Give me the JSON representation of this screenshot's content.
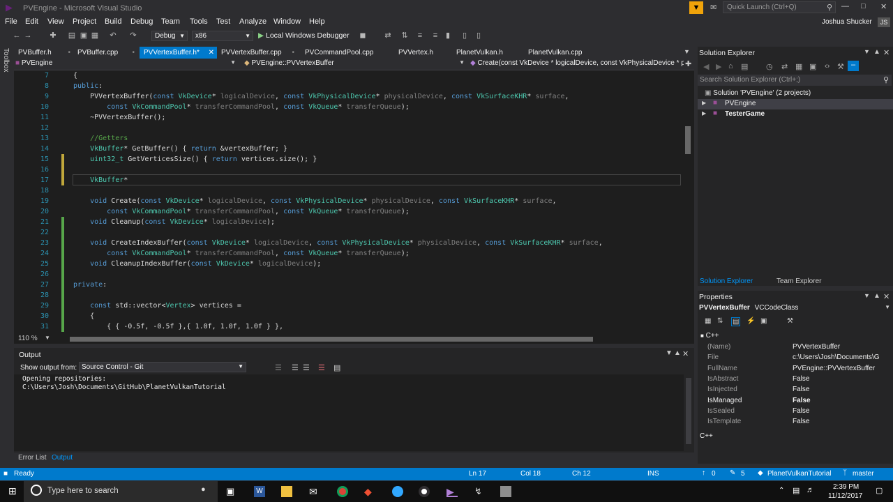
{
  "window": {
    "title": "PVEngine - Microsoft Visual Studio",
    "quick_launch": "Quick Launch (Ctrl+Q)",
    "user": "Joshua Shucker",
    "user_initials": "JS"
  },
  "menu": [
    "File",
    "Edit",
    "View",
    "Project",
    "Build",
    "Debug",
    "Team",
    "Tools",
    "Test",
    "Analyze",
    "Window",
    "Help"
  ],
  "toolbar": {
    "config": "Debug",
    "platform": "x86",
    "debugger": "Local Windows Debugger"
  },
  "tabs": [
    {
      "label": "PVBuffer.h",
      "active": false
    },
    {
      "label": "PVBuffer.cpp",
      "active": false
    },
    {
      "label": "PVVertexBuffer.h*",
      "active": true
    },
    {
      "label": "PVVertexBuffer.cpp",
      "active": false
    },
    {
      "label": "PVCommandPool.cpp",
      "active": false
    },
    {
      "label": "PVVertex.h",
      "active": false
    },
    {
      "label": "PlanetVulkan.h",
      "active": false
    },
    {
      "label": "PlanetVulkan.cpp",
      "active": false
    }
  ],
  "navbar": {
    "project": "PVEngine",
    "scope": "PVEngine::PVVertexBuffer",
    "member": "Create(const VkDevice * logicalDevice, const VkPhysicalDevice * phys"
  },
  "sidebar_label": "Toolbox",
  "code": [
    {
      "n": "7",
      "t": "    {"
    },
    {
      "n": "8",
      "t": "    public:"
    },
    {
      "n": "9",
      "t": "        PVVertexBuffer(const VkDevice* logicalDevice, const VkPhysicalDevice* physicalDevice, const VkSurfaceKHR* surface,"
    },
    {
      "n": "10",
      "t": "            const VkCommandPool* transferCommandPool, const VkQueue* transferQueue);"
    },
    {
      "n": "11",
      "t": "        ~PVVertexBuffer();"
    },
    {
      "n": "12",
      "t": ""
    },
    {
      "n": "13",
      "t": "        //Getters"
    },
    {
      "n": "14",
      "t": "        VkBuffer* GetBuffer() { return &vertexBuffer; }"
    },
    {
      "n": "15",
      "t": "        uint32_t GetVerticesSize() { return vertices.size(); }"
    },
    {
      "n": "16",
      "t": ""
    },
    {
      "n": "17",
      "t": "        VkBuffer*"
    },
    {
      "n": "18",
      "t": ""
    },
    {
      "n": "19",
      "t": "        void Create(const VkDevice* logicalDevice, const VkPhysicalDevice* physicalDevice, const VkSurfaceKHR* surface,"
    },
    {
      "n": "20",
      "t": "            const VkCommandPool* transferCommandPool, const VkQueue* transferQueue);"
    },
    {
      "n": "21",
      "t": "        void Cleanup(const VkDevice* logicalDevice);"
    },
    {
      "n": "22",
      "t": ""
    },
    {
      "n": "23",
      "t": "        void CreateIndexBuffer(const VkDevice* logicalDevice, const VkPhysicalDevice* physicalDevice, const VkSurfaceKHR* surface,"
    },
    {
      "n": "24",
      "t": "            const VkCommandPool* transferCommandPool, const VkQueue* transferQueue);"
    },
    {
      "n": "25",
      "t": "        void CleanupIndexBuffer(const VkDevice* logicalDevice);"
    },
    {
      "n": "26",
      "t": ""
    },
    {
      "n": "27",
      "t": "    private:"
    },
    {
      "n": "28",
      "t": ""
    },
    {
      "n": "29",
      "t": "        const std::vector<Vertex> vertices ="
    },
    {
      "n": "30",
      "t": "        {"
    },
    {
      "n": "31",
      "t": "            { { -0.5f, -0.5f },{ 1.0f, 1.0f, 1.0f } },"
    }
  ],
  "zoom": "110 %",
  "output": {
    "title": "Output",
    "show_from_label": "Show output from:",
    "source": "Source Control - Git",
    "lines": [
      "Opening repositories:",
      "C:\\Users\\Josh\\Documents\\GitHub\\PlanetVulkanTutorial"
    ]
  },
  "bottom_tabs": [
    "Error List",
    "Output"
  ],
  "solution_explorer": {
    "title": "Solution Explorer",
    "search_placeholder": "Search Solution Explorer (Ctrl+;)",
    "solution": "Solution 'PVEngine' (2 projects)",
    "projects": [
      "PVEngine",
      "TesterGame"
    ],
    "tabs": [
      "Solution Explorer",
      "Team Explorer"
    ]
  },
  "properties": {
    "title": "Properties",
    "object": "PVVertexBuffer",
    "object_type": "VCCodeClass",
    "category": "C++",
    "rows": [
      {
        "name": "(Name)",
        "value": "PVVertexBuffer"
      },
      {
        "name": "File",
        "value": "c:\\Users\\Josh\\Documents\\G"
      },
      {
        "name": "FullName",
        "value": "PVEngine::PVVertexBuffer"
      },
      {
        "name": "IsAbstract",
        "value": "False"
      },
      {
        "name": "IsInjected",
        "value": "False"
      },
      {
        "name": "IsManaged",
        "value": "False"
      },
      {
        "name": "IsSealed",
        "value": "False"
      },
      {
        "name": "IsTemplate",
        "value": "False"
      }
    ],
    "footer": "C++"
  },
  "status": {
    "ready": "Ready",
    "ln": "Ln 17",
    "col": "Col 18",
    "ch": "Ch 12",
    "ins": "INS",
    "up": "0",
    "pencil": "5",
    "repo": "PlanetVulkanTutorial",
    "branch": "master"
  },
  "taskbar": {
    "search": "Type here to search",
    "time": "2:39 PM",
    "date": "11/12/2017"
  }
}
